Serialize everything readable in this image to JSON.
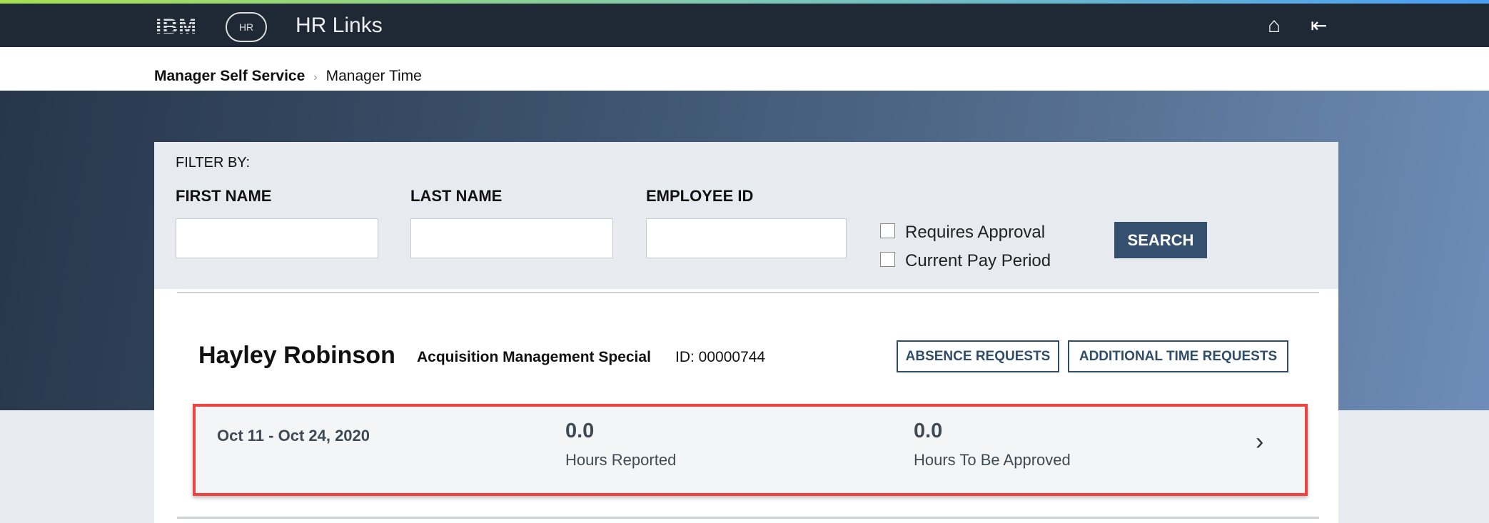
{
  "header": {
    "brand": "IBM",
    "logo_text": "HR",
    "title": "HR Links",
    "icons": [
      "home-icon",
      "sign-out-icon"
    ]
  },
  "breadcrumb": {
    "root": "Manager Self Service",
    "current": "Manager Time"
  },
  "filter": {
    "heading": "FILTER BY:",
    "first_name_label": "FIRST NAME",
    "last_name_label": "LAST NAME",
    "employee_id_label": "EMPLOYEE ID",
    "first_name_value": "",
    "last_name_value": "",
    "employee_id_value": "",
    "requires_approval_label": "Requires Approval",
    "current_pay_period_label": "Current Pay Period",
    "requires_approval_checked": false,
    "current_pay_period_checked": false,
    "search_label": "SEARCH"
  },
  "employee": {
    "name": "Hayley Robinson",
    "position": "Acquisition Management Special",
    "id_text": "ID: 00000744",
    "absence_label": "ABSENCE REQUESTS",
    "additional_label": "ADDITIONAL TIME REQUESTS"
  },
  "period": {
    "dates": "Oct 11 - Oct 24, 2020",
    "hours_reported": "0.0",
    "hours_reported_label": "Hours Reported",
    "hours_to_approve": "0.0",
    "hours_to_approve_label": "Hours To Be Approved"
  }
}
